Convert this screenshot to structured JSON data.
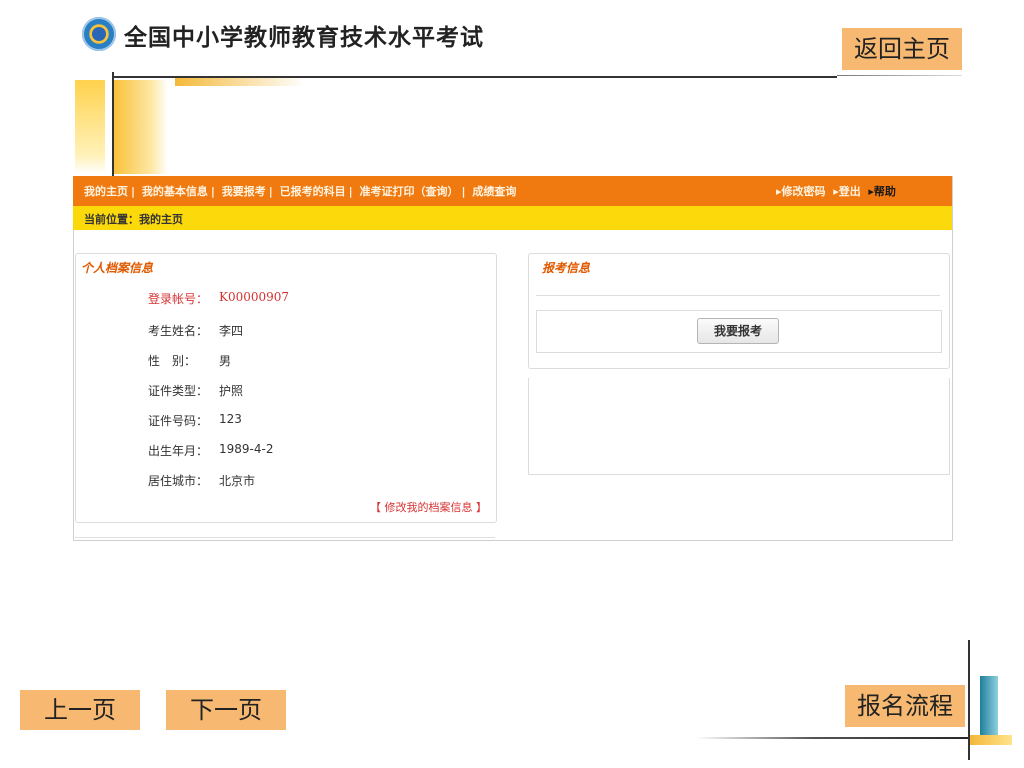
{
  "header": {
    "title": "全国中小学教师教育技术水平考试",
    "home_button": "返回主页"
  },
  "nav": {
    "left_items": [
      "我的主页",
      "我的基本信息",
      "我要报考",
      "已报考的科目",
      "准考证打印（查询）",
      "成绩查询"
    ],
    "right_items": [
      "▸修改密码",
      "▸登出",
      "▸帮助"
    ]
  },
  "location": "当前位置：我的主页",
  "profile": {
    "title": "个人档案信息",
    "rows": [
      {
        "label": "登录帐号：",
        "value": "K00000907"
      },
      {
        "label": "考生姓名：",
        "value": "李四"
      },
      {
        "label": "性　别：",
        "value": "男"
      },
      {
        "label": "证件类型：",
        "value": "护照"
      },
      {
        "label": "证件号码：",
        "value": "123"
      },
      {
        "label": "出生年月：",
        "value": "1989-4-2"
      },
      {
        "label": "居住城市：",
        "value": "北京市"
      }
    ],
    "edit_link": "【 修改我的档案信息 】"
  },
  "registration": {
    "title": "报考信息",
    "apply_button": "我要报考"
  },
  "footer": {
    "prev": "上一页",
    "next": "下一页",
    "flow": "报名流程"
  },
  "colors": {
    "nav_bar": "#f07a10",
    "location_bar": "#fbd90a",
    "button_fill": "#f7b972",
    "accent_red": "#d83232"
  }
}
